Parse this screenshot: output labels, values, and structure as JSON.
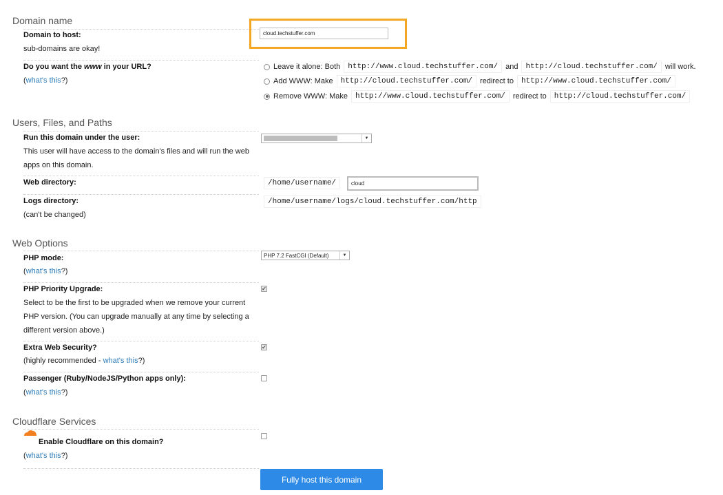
{
  "sections": {
    "domain_name": "Domain name",
    "users_files_paths": "Users, Files, and Paths",
    "web_options": "Web Options",
    "cloudflare": "Cloudflare Services"
  },
  "domain": {
    "label": "Domain to host:",
    "desc": "sub-domains are okay!",
    "value": "cloud.techstuffer.com"
  },
  "www": {
    "label_pre": "Do you want the ",
    "label_em": "www",
    "label_post": " in your URL?",
    "paren_open": "(",
    "whats_this": "what's this",
    "paren_close": "?)",
    "options": [
      {
        "text1": "Leave it alone: Both",
        "code1": "http://www.cloud.techstuffer.com/",
        "text2": "and",
        "code2": "http://cloud.techstuffer.com/",
        "text3": "will work."
      },
      {
        "text1": "Add WWW: Make",
        "code1": "http://cloud.techstuffer.com/",
        "text2": "redirect to",
        "code2": "http://www.cloud.techstuffer.com/",
        "text3": ""
      },
      {
        "text1": "Remove WWW: Make",
        "code1": "http://www.cloud.techstuffer.com/",
        "text2": "redirect to",
        "code2": "http://cloud.techstuffer.com/",
        "text3": ""
      }
    ],
    "selected_index": 2
  },
  "user": {
    "label": "Run this domain under the user:",
    "desc": "This user will have access to the domain's files and will run the web apps on this domain."
  },
  "webdir": {
    "label": "Web directory:",
    "prefix": "/home/username/",
    "value": "cloud"
  },
  "logsdir": {
    "label": "Logs directory:",
    "note": "(can't be changed)",
    "path": "/home/username/logs/cloud.techstuffer.com/http"
  },
  "php": {
    "label": "PHP mode:",
    "paren_open": "(",
    "whats_this": "what's this",
    "paren_close": "?)",
    "selected": "PHP 7.2 FastCGI (Default)"
  },
  "php_priority": {
    "label": "PHP Priority Upgrade:",
    "desc": "Select to be the first to be upgraded when we remove your current PHP version. (You can upgrade manually at any time by selecting a different version above.)",
    "checked": true
  },
  "extra_security": {
    "label": "Extra Web Security?",
    "note_pre": "(highly recommended - ",
    "whats_this": "what's this",
    "note_post": "?)",
    "checked": true
  },
  "passenger": {
    "label": "Passenger (Ruby/NodeJS/Python apps only):",
    "paren_open": "(",
    "whats_this": "what's this",
    "paren_close": "?)",
    "checked": false
  },
  "cloudflare": {
    "label": "Enable Cloudflare on this domain?",
    "paren_open": "(",
    "whats_this": "what's this",
    "paren_close": "?)",
    "checked": false
  },
  "submit": {
    "label": "Fully host this domain"
  },
  "colors": {
    "highlight": "#f5a623",
    "link": "#2b7bb9",
    "button": "#2d8ae6",
    "cloudflare": "#f38020"
  }
}
